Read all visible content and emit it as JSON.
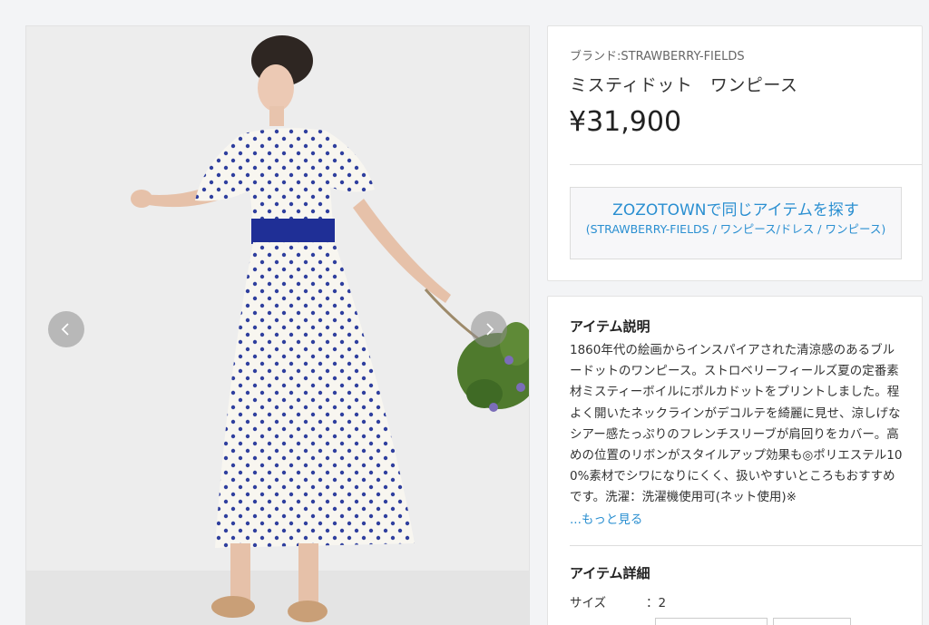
{
  "product": {
    "brand": "ブランド:STRAWBERRY-FIELDS",
    "title": "ミスティドット　ワンピース",
    "price": "¥31,900"
  },
  "zozotown": {
    "main_label": "ZOZOTOWNで同じアイテムを探す",
    "sub_label": "(STRAWBERRY-FIELDS / ワンピース/ドレス / ワンピース)"
  },
  "description": {
    "heading": "アイテム説明",
    "text": "1860年代の絵画からインスパイアされた清涼感のあるブルードットのワンピース。ストロベリーフィールズ夏の定番素材ミスティーボイルにポルカドットをプリントしました。程よく開いたネックラインがデコルテを綺麗に見せ、涼しげなシアー感たっぷりのフレンチスリーブが肩回りをカバー。高めの位置のリボンがスタイルアップ効果も◎ポリエステル100%素材でシワになりにくく、扱いやすいところもおすすめです。洗濯：洗濯機使用可(ネット使用)※",
    "more_link": "...もっと見る"
  },
  "details": {
    "heading": "アイテム詳細",
    "size_label": "サイズ",
    "size_value": "：2"
  },
  "gallery": {
    "prev_icon": "chevron-left-icon",
    "next_icon": "chevron-right-icon"
  }
}
